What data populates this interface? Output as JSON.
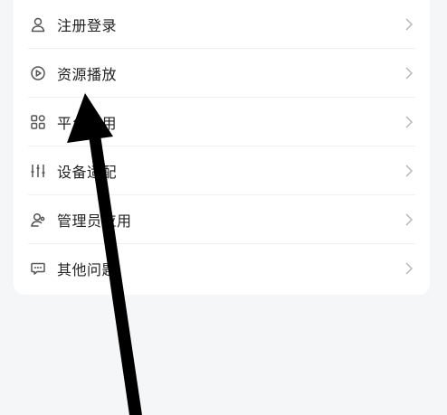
{
  "menu": {
    "items": [
      {
        "label": "注册登录",
        "icon": "user-icon"
      },
      {
        "label": "资源播放",
        "icon": "play-circle-icon"
      },
      {
        "label": "平台应用",
        "icon": "grid-apps-icon"
      },
      {
        "label": "设备适配",
        "icon": "sliders-icon"
      },
      {
        "label": "管理员应用",
        "icon": "admin-user-icon"
      },
      {
        "label": "其他问题",
        "icon": "chat-bubble-icon"
      }
    ]
  },
  "colors": {
    "background": "#f5f6f8",
    "card": "#ffffff",
    "text": "#222222",
    "icon": "#555555",
    "chevron": "#b8b8b8",
    "divider": "#eef0f2",
    "arrow": "#000000"
  }
}
